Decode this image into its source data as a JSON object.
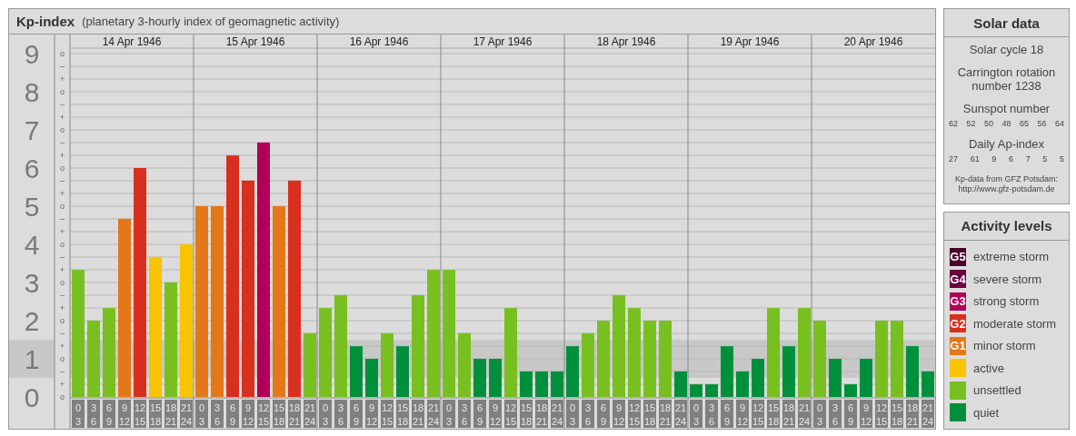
{
  "chart": {
    "title": "Kp-index",
    "subtitle": "(planetary 3-hourly index of geomagnetic activity)",
    "days": [
      {
        "label": "14 Apr 1946",
        "slots": [
          [
            "0",
            "3"
          ],
          [
            "3",
            "6"
          ],
          [
            "6",
            "9"
          ],
          [
            "9",
            "12"
          ],
          [
            "12",
            "15"
          ],
          [
            "15",
            "18"
          ],
          [
            "18",
            "21"
          ],
          [
            "21",
            "24"
          ]
        ]
      },
      {
        "label": "15 Apr 1946",
        "slots": [
          [
            "0",
            "3"
          ],
          [
            "3",
            "6"
          ],
          [
            "6",
            "9"
          ],
          [
            "9",
            "12"
          ],
          [
            "12",
            "15"
          ],
          [
            "15",
            "18"
          ],
          [
            "18",
            "21"
          ],
          [
            "21",
            "24"
          ]
        ]
      },
      {
        "label": "16 Apr 1946",
        "slots": [
          [
            "0",
            "3"
          ],
          [
            "3",
            "6"
          ],
          [
            "6",
            "9"
          ],
          [
            "9",
            "12"
          ],
          [
            "12",
            "15"
          ],
          [
            "15",
            "18"
          ],
          [
            "18",
            "21"
          ],
          [
            "21",
            "24"
          ]
        ]
      },
      {
        "label": "17 Apr 1946",
        "slots": [
          [
            "0",
            "3"
          ],
          [
            "3",
            "6"
          ],
          [
            "6",
            "9"
          ],
          [
            "9",
            "12"
          ],
          [
            "12",
            "15"
          ],
          [
            "15",
            "18"
          ],
          [
            "18",
            "21"
          ],
          [
            "21",
            "24"
          ]
        ]
      },
      {
        "label": "18 Apr 1946",
        "slots": [
          [
            "0",
            "3"
          ],
          [
            "3",
            "6"
          ],
          [
            "6",
            "9"
          ],
          [
            "9",
            "12"
          ],
          [
            "12",
            "15"
          ],
          [
            "15",
            "18"
          ],
          [
            "18",
            "21"
          ],
          [
            "21",
            "24"
          ]
        ]
      },
      {
        "label": "19 Apr 1946",
        "slots": [
          [
            "0",
            "3"
          ],
          [
            "3",
            "6"
          ],
          [
            "6",
            "9"
          ],
          [
            "9",
            "12"
          ],
          [
            "12",
            "15"
          ],
          [
            "15",
            "18"
          ],
          [
            "18",
            "21"
          ],
          [
            "21",
            "24"
          ]
        ]
      },
      {
        "label": "20 Apr 1946",
        "slots": [
          [
            "0",
            "3"
          ],
          [
            "3",
            "6"
          ],
          [
            "6",
            "9"
          ],
          [
            "9",
            "12"
          ],
          [
            "12",
            "15"
          ],
          [
            "15",
            "18"
          ],
          [
            "18",
            "21"
          ],
          [
            "21",
            "24"
          ]
        ]
      }
    ],
    "fraction_marks": [
      "o",
      "–",
      "+",
      "o",
      "–",
      "+",
      "o",
      "–",
      "+",
      "o",
      "–",
      "+",
      "o",
      "–",
      "+",
      "o",
      "–",
      "+",
      "o",
      "–",
      "+",
      "o",
      "–",
      "+",
      "o",
      "–",
      "+",
      "o"
    ],
    "chart_data": {
      "type": "bar",
      "ylim": [
        0,
        9
      ],
      "yticks": [
        0,
        1,
        2,
        3,
        4,
        5,
        6,
        7,
        8,
        9
      ],
      "grid": true,
      "series": [
        {
          "color": "#00903c",
          "values": [
            null,
            null,
            null,
            null,
            null,
            null,
            null,
            null,
            null,
            null,
            null,
            null,
            null,
            null,
            null,
            null,
            null,
            null,
            1.33,
            1,
            null,
            1.33,
            null,
            null,
            null,
            null,
            1,
            1,
            null,
            0.67,
            0.67,
            0.67,
            1.33,
            null,
            null,
            null,
            null,
            null,
            null,
            0.67,
            0.33,
            0.33,
            1.33,
            0.67,
            1,
            null,
            1.33,
            null,
            null,
            1,
            0.33,
            1,
            null,
            null,
            1.33,
            0.67
          ]
        },
        {
          "color": "#78c020",
          "values": [
            3.33,
            2,
            2.33,
            null,
            null,
            null,
            3,
            null,
            null,
            null,
            null,
            null,
            null,
            null,
            null,
            1.67,
            2.33,
            2.67,
            null,
            null,
            1.67,
            null,
            2.67,
            3.33,
            3.33,
            1.67,
            null,
            null,
            2.33,
            null,
            null,
            null,
            null,
            1.67,
            2,
            2.67,
            2.33,
            2,
            2,
            null,
            null,
            null,
            null,
            null,
            null,
            2.33,
            null,
            2.33,
            2,
            null,
            null,
            null,
            2,
            2,
            null,
            null
          ]
        },
        {
          "color": "#f8c400",
          "values": [
            null,
            null,
            null,
            null,
            null,
            3.67,
            null,
            4,
            null,
            null,
            null,
            null,
            null,
            null,
            null,
            null,
            null,
            null,
            null,
            null,
            null,
            null,
            null,
            null,
            null,
            null,
            null,
            null,
            null,
            null,
            null,
            null,
            null,
            null,
            null,
            null,
            null,
            null,
            null,
            null,
            null,
            null,
            null,
            null,
            null,
            null,
            null,
            null,
            null,
            null,
            null,
            null,
            null,
            null,
            null,
            null
          ]
        },
        {
          "color": "#e47718",
          "values": [
            null,
            null,
            null,
            4.67,
            null,
            null,
            null,
            null,
            5,
            5,
            null,
            null,
            null,
            5,
            null,
            null,
            null,
            null,
            null,
            null,
            null,
            null,
            null,
            null,
            null,
            null,
            null,
            null,
            null,
            null,
            null,
            null,
            null,
            null,
            null,
            null,
            null,
            null,
            null,
            null,
            null,
            null,
            null,
            null,
            null,
            null,
            null,
            null,
            null,
            null,
            null,
            null,
            null,
            null,
            null,
            null
          ]
        },
        {
          "color": "#d8301e",
          "values": [
            null,
            null,
            null,
            null,
            6,
            null,
            null,
            null,
            null,
            null,
            6.33,
            5.67,
            null,
            null,
            5.67,
            null,
            null,
            null,
            null,
            null,
            null,
            null,
            null,
            null,
            null,
            null,
            null,
            null,
            null,
            null,
            null,
            null,
            null,
            null,
            null,
            null,
            null,
            null,
            null,
            null,
            null,
            null,
            null,
            null,
            null,
            null,
            null,
            null,
            null,
            null,
            null,
            null,
            null,
            null,
            null,
            null
          ]
        },
        {
          "color": "#b00058",
          "values": [
            null,
            null,
            null,
            null,
            null,
            null,
            null,
            null,
            null,
            null,
            null,
            null,
            6.67,
            null,
            null,
            null,
            null,
            null,
            null,
            null,
            null,
            null,
            null,
            null,
            null,
            null,
            null,
            null,
            null,
            null,
            null,
            null,
            null,
            null,
            null,
            null,
            null,
            null,
            null,
            null,
            null,
            null,
            null,
            null,
            null,
            null,
            null,
            null,
            null,
            null,
            null,
            null,
            null,
            null,
            null,
            null
          ]
        }
      ]
    }
  },
  "solar_data": {
    "title": "Solar data",
    "solar_cycle": "Solar cycle 18",
    "carrington": "Carrington rotation number 1238",
    "sunspot_title": "Sunspot number",
    "sunspot_numbers": [
      "62",
      "52",
      "50",
      "48",
      "65",
      "56",
      "64"
    ],
    "ap_title": "Daily Ap-index",
    "ap_values": [
      "27",
      "61",
      "9",
      "6",
      "7",
      "5",
      "5"
    ],
    "source_lines": [
      "Kp-data from GFZ Potsdam:",
      "http://www.gfz-potsdam.de"
    ]
  },
  "legend": {
    "title": "Activity levels",
    "items": [
      {
        "badge": "G5",
        "label": "extreme storm",
        "color": "#4a0028"
      },
      {
        "badge": "G4",
        "label": "severe storm",
        "color": "#6b0040"
      },
      {
        "badge": "G3",
        "label": "strong storm",
        "color": "#b00058"
      },
      {
        "badge": "G2",
        "label": "moderate storm",
        "color": "#d8301e"
      },
      {
        "badge": "G1",
        "label": "minor storm",
        "color": "#e47718"
      },
      {
        "label": "active",
        "color": "#f8c400"
      },
      {
        "label": "unsettled",
        "color": "#78c020"
      },
      {
        "label": "quiet",
        "color": "#00903c"
      }
    ]
  }
}
